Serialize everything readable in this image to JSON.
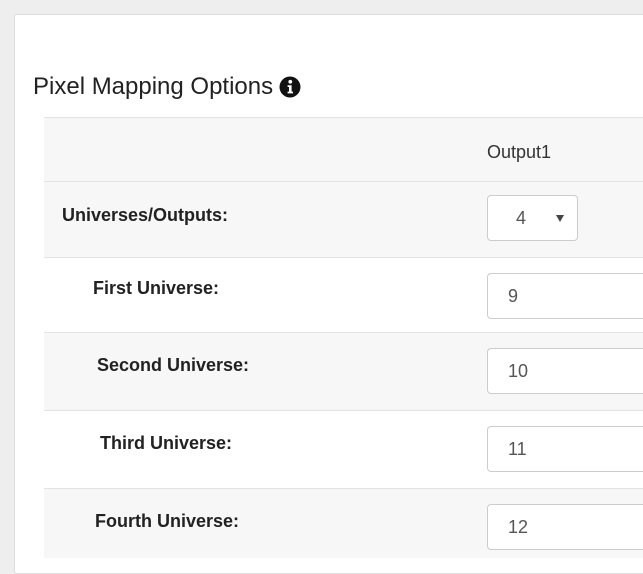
{
  "panel": {
    "title": "Pixel Mapping Options",
    "title_icon": "info-circle-icon"
  },
  "table": {
    "column_header": "Output1",
    "universes": {
      "label": "Universes/Outputs:",
      "selected": "4"
    },
    "rows": [
      {
        "label": "First Universe:",
        "value": "9"
      },
      {
        "label": "Second Universe:",
        "value": "10"
      },
      {
        "label": "Third Universe:",
        "value": "11"
      },
      {
        "label": "Fourth Universe:",
        "value": "12"
      }
    ]
  },
  "colors": {
    "stripe": "#f7f7f7",
    "border": "#cccccc",
    "text": "#222222"
  }
}
